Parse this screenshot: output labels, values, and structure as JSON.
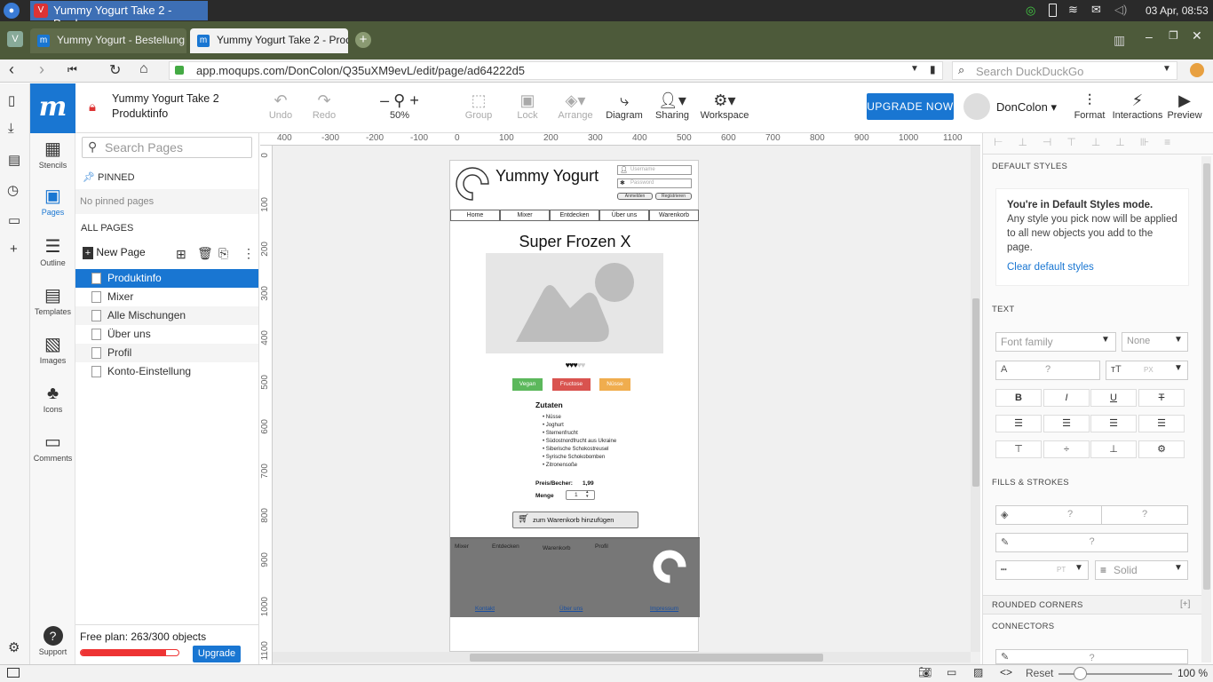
{
  "os": {
    "window_title": "Yummy Yogurt Take 2 - Prod...",
    "clock": "03 Apr, 08:53"
  },
  "browser": {
    "tabs": [
      {
        "label": "Yummy Yogurt - Bestellung"
      },
      {
        "label": "Yummy Yogurt Take 2 - Prod"
      }
    ],
    "url": "app.moqups.com/DonColon/Q35uXM9evL/edit/page/ad64222d5",
    "search_placeholder": "Search DuckDuckGo"
  },
  "app": {
    "project_name": "Yummy Yogurt Take 2",
    "page_name": "Produktinfo",
    "toolbar": {
      "undo": "Undo",
      "redo": "Redo",
      "zoom": "50%",
      "group": "Group",
      "lock": "Lock",
      "arrange": "Arrange",
      "diagram": "Diagram",
      "sharing": "Sharing",
      "workspace": "Workspace",
      "upgrade": "UPGRADE NOW",
      "user": "DonColon",
      "format": "Format",
      "interactions": "Interactions",
      "preview": "Preview"
    },
    "stencils": [
      "Stencils",
      "Pages",
      "Outline",
      "Templates",
      "Images",
      "Icons",
      "Comments"
    ],
    "support": "Support"
  },
  "pages_panel": {
    "search_placeholder": "Search Pages",
    "pinned_title": "PINNED",
    "no_pinned": "No pinned pages",
    "all_pages_title": "ALL PAGES",
    "new_page": "New Page",
    "pages": [
      "Produktinfo",
      "Mixer",
      "Alle Mischungen",
      "Über uns",
      "Profil",
      "Konto-Einstellung"
    ],
    "plan_text": "Free plan: 263/300 objects",
    "plan_usage": 0.877,
    "upgrade": "Upgrade"
  },
  "ruler": {
    "h_labels": [
      "400",
      "-300",
      "-200",
      "-100",
      "0",
      "100",
      "200",
      "300",
      "400",
      "500",
      "600",
      "700",
      "800",
      "900",
      "1000",
      "1100"
    ],
    "v_labels": [
      "0",
      "100",
      "200",
      "300",
      "400",
      "500",
      "600",
      "700",
      "800",
      "900",
      "1000",
      "1100"
    ]
  },
  "mockup": {
    "logo_text": "Yummy Yogurt",
    "username_placeholder": "Username",
    "password_placeholder": "Password",
    "login": "Anmelden",
    "register": "Registrieren",
    "nav": [
      "Home",
      "Mixer",
      "Entdecken",
      "Über uns",
      "Warenkorb"
    ],
    "product_title": "Super Frozen X",
    "hearts": "♥♥♥♥♥",
    "rating": 3,
    "tags": [
      {
        "label": "Vegan",
        "color": "#5cb85c"
      },
      {
        "label": "Fructose",
        "color": "#d9534f"
      },
      {
        "label": "Nüsse",
        "color": "#f0ad4e"
      }
    ],
    "ingredients_title": "Zutaten",
    "ingredients": [
      "Nüsse",
      "Joghurt",
      "Sternenfrucht",
      "Südostnordfrucht aus Ukraine",
      "Siberische Schokostreusel",
      "Syrische Schokobomben",
      "Zitronensoße"
    ],
    "price_label": "Preis/Becher:",
    "price_value": "1,99",
    "qty_label": "Menge",
    "qty_value": "1",
    "cart_button": "zum Warenkorb hinzufügen",
    "footer_nav": [
      "Mixer",
      "Entdecken",
      "Warenkorb",
      "Profil"
    ],
    "footer_links": [
      "Kontakt",
      "Über uns",
      "Impressum"
    ]
  },
  "format_panel": {
    "default_styles_title": "DEFAULT STYLES",
    "default_mode_heading": "You're in Default Styles mode.",
    "default_mode_body": "Any style you pick now will be applied to all new objects you add to the page.",
    "clear_link": "Clear default styles",
    "text_title": "TEXT",
    "font_family_placeholder": "Font family",
    "none": "None",
    "q": "?",
    "px": "PX",
    "pt": "PT",
    "bold": "B",
    "italic": "I",
    "underline": "U",
    "strike": "T",
    "fills_title": "FILLS & STROKES",
    "solid": "Solid",
    "rounded_title": "ROUNDED CORNERS",
    "rounded_add": "[+]",
    "connectors_title": "CONNECTORS"
  },
  "bottom": {
    "reset": "Reset",
    "zoom": "100 %"
  }
}
